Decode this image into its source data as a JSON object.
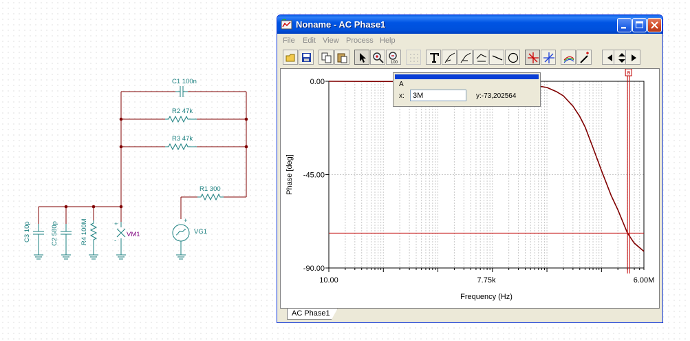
{
  "schematic": {
    "components": [
      {
        "id": "c1",
        "label": "C1 100n"
      },
      {
        "id": "r2",
        "label": "R2 47k"
      },
      {
        "id": "r3",
        "label": "R3 47k"
      },
      {
        "id": "r1",
        "label": "R1 300"
      },
      {
        "id": "c3",
        "label": "C3 10p"
      },
      {
        "id": "c2",
        "label": "C2 580p"
      },
      {
        "id": "r4",
        "label": "R4 100M"
      },
      {
        "id": "vm1",
        "label": "VM1"
      },
      {
        "id": "vg1",
        "label": "VG1"
      }
    ]
  },
  "window": {
    "title": "Noname - AC Phase1",
    "menu": [
      "File",
      "Edit",
      "View",
      "Process",
      "Help"
    ],
    "tab_label": "AC Phase1"
  },
  "toolbar": {
    "tools": [
      "open-icon",
      "save-icon",
      "copy-icon",
      "paste-icon",
      "pointer-icon",
      "zoom-in-icon",
      "zoom-out-icon",
      "grid-icon",
      "text-icon",
      "annotate-icon",
      "annotate2-icon",
      "annotate3-icon",
      "line-icon",
      "circle-icon",
      "cursor-a-icon",
      "cursor-b-icon",
      "curves-icon",
      "marker-icon",
      "left-arrow-icon",
      "up-down-icon",
      "right-arrow-icon"
    ],
    "zoom_out_badge": "100"
  },
  "cursor_panel": {
    "name": "A",
    "x_label": "x:",
    "x_value": "3M",
    "y_text": "y:-73,202564",
    "marker_label": "a"
  },
  "chart_data": {
    "type": "line",
    "xscale": "log",
    "xlim": [
      10,
      6000000
    ],
    "ylim": [
      -90,
      0
    ],
    "xticks": [
      "10.00",
      "7.75k",
      "6.00M"
    ],
    "yticks": [
      "0.00",
      "-45.00",
      "-90.00"
    ],
    "xlabel": "Frequency (Hz)",
    "ylabel": "Phase [deg]",
    "grid": true,
    "series": [
      {
        "color": "#800000",
        "x": [
          10,
          1000,
          10000,
          30000,
          60000,
          100000,
          150000,
          200000,
          300000,
          400000,
          500000,
          700000,
          1000000,
          1500000,
          2000000,
          3000000,
          4000000,
          6000000
        ],
        "y": [
          0,
          -0.2,
          -0.5,
          -1,
          -2,
          -3,
          -5,
          -7,
          -12,
          -17,
          -22,
          -32,
          -43,
          -55,
          -62,
          -73.2,
          -78,
          -82
        ]
      }
    ],
    "cursor": {
      "x": 3000000,
      "y": -73.202564
    }
  }
}
